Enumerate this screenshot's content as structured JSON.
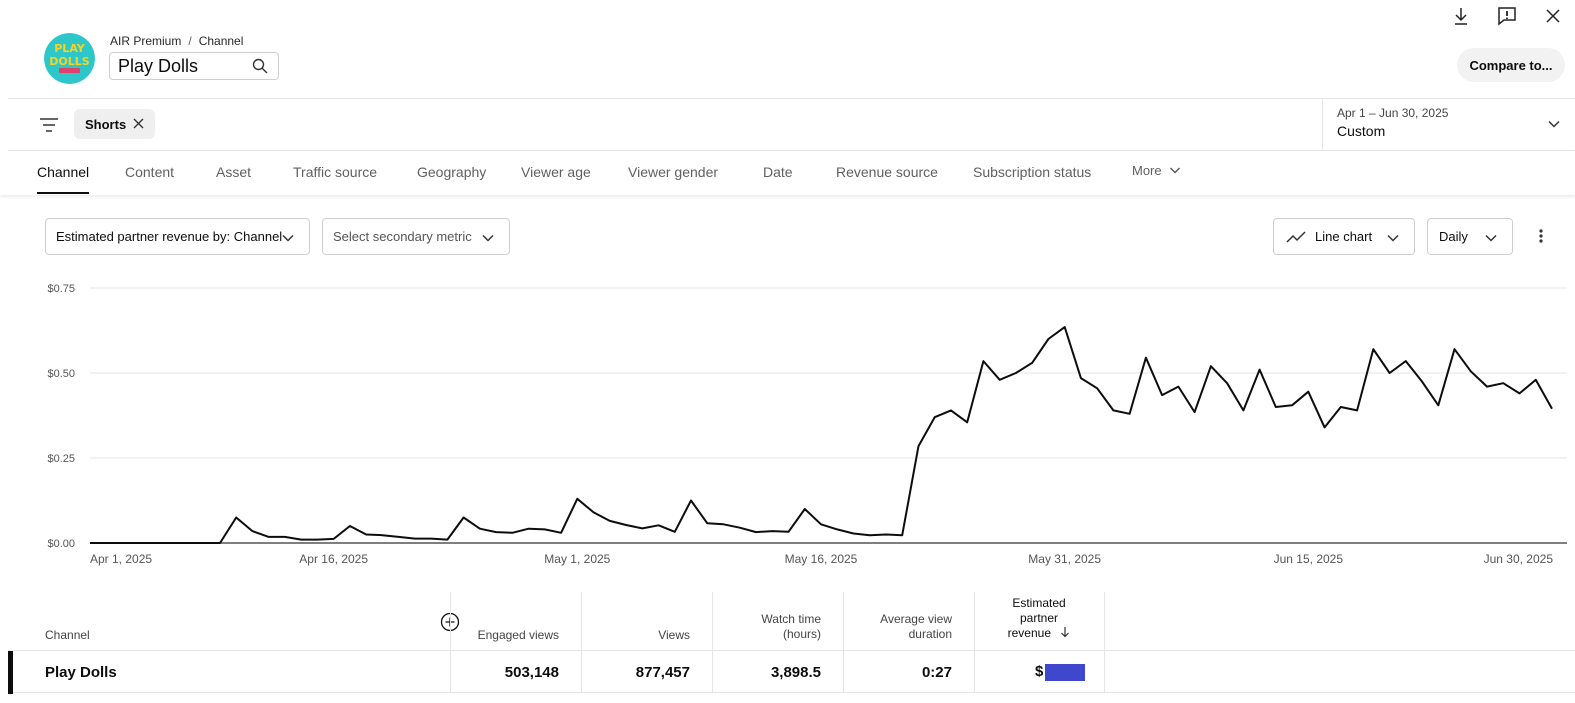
{
  "header": {
    "breadcrumb": {
      "org": "AIR Premium",
      "separator": "/",
      "level": "Channel"
    },
    "channel_name": "Play Dolls",
    "compare_label": "Compare to...",
    "logo_text": [
      "PLAY",
      "DOLLS"
    ]
  },
  "filters": {
    "chip_label": "Shorts",
    "date_range": "Apr 1 – Jun 30, 2025",
    "date_mode": "Custom"
  },
  "tabs": [
    {
      "label": "Channel"
    },
    {
      "label": "Content"
    },
    {
      "label": "Asset"
    },
    {
      "label": "Traffic source"
    },
    {
      "label": "Geography"
    },
    {
      "label": "Viewer age"
    },
    {
      "label": "Viewer gender"
    },
    {
      "label": "Date"
    },
    {
      "label": "Revenue source"
    },
    {
      "label": "Subscription status"
    },
    {
      "label": "More"
    }
  ],
  "controls": {
    "primary_metric": "Estimated partner revenue by: Channel",
    "secondary_metric": "Select secondary metric",
    "chart_type": "Line chart",
    "granularity": "Daily"
  },
  "chart_data": {
    "type": "line",
    "x_start": "2025-04-01",
    "x_end": "2025-06-30",
    "ylim": [
      0,
      0.75
    ],
    "y_ticks": [
      "$0.75",
      "$0.50",
      "$0.25",
      "$0.00"
    ],
    "x_ticks": [
      "Apr 1, 2025",
      "Apr 16, 2025",
      "May 1, 2025",
      "May 16, 2025",
      "May 31, 2025",
      "Jun 15, 2025",
      "Jun 30, 2025"
    ],
    "grid": true,
    "series": [
      {
        "values": [
          0,
          0,
          0,
          0,
          0,
          0,
          0,
          0,
          0,
          0.075,
          0.035,
          0.018,
          0.018,
          0.01,
          0.01,
          0.012,
          0.05,
          0.025,
          0.023,
          0.018,
          0.013,
          0.013,
          0.01,
          0.075,
          0.042,
          0.032,
          0.03,
          0.042,
          0.04,
          0.03,
          0.13,
          0.09,
          0.065,
          0.053,
          0.043,
          0.052,
          0.033,
          0.125,
          0.058,
          0.055,
          0.045,
          0.032,
          0.035,
          0.033,
          0.1,
          0.055,
          0.04,
          0.028,
          0.023,
          0.025,
          0.023,
          0.285,
          0.37,
          0.39,
          0.355,
          0.535,
          0.48,
          0.5,
          0.53,
          0.6,
          0.635,
          0.485,
          0.455,
          0.39,
          0.38,
          0.545,
          0.435,
          0.46,
          0.385,
          0.52,
          0.47,
          0.39,
          0.51,
          0.4,
          0.405,
          0.445,
          0.34,
          0.4,
          0.39,
          0.57,
          0.5,
          0.535,
          0.475,
          0.405,
          0.57,
          0.505,
          0.46,
          0.47,
          0.44,
          0.48,
          0.395
        ]
      }
    ]
  },
  "table": {
    "headers": {
      "channel": "Channel",
      "engaged_views": "Engaged views",
      "views": "Views",
      "watch_time": [
        "Watch time",
        "(hours)"
      ],
      "avg_view_duration": [
        "Average view",
        "duration"
      ],
      "revenue": [
        "Estimated",
        "partner",
        "revenue"
      ]
    },
    "row": {
      "channel": "Play Dolls",
      "engaged_views": "503,148",
      "views": "877,457",
      "watch_time": "3,898.5",
      "avg_view_duration": "0:27",
      "revenue_prefix": "$"
    }
  },
  "colors": {
    "accent_line": "#0d0d0d",
    "redaction": "#3f48cc",
    "logo_bg": "#2ec7c9",
    "logo_text": "#f7d324"
  }
}
